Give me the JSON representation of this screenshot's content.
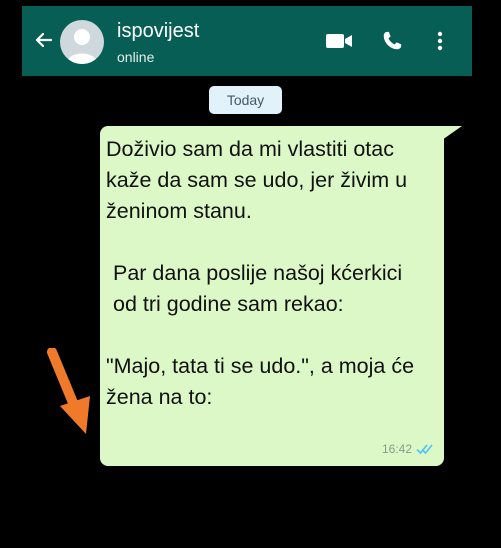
{
  "header": {
    "contact_name": "ispovijest",
    "status": "online"
  },
  "date_label": "Today",
  "message": {
    "paragraphs": [
      "Doživio sam da mi vlastiti otac kaže da sam se udo, jer živim u ženinom stanu.",
      "Par dana poslije našoj kćerkici od tri godine sam rekao:",
      "\"Majo, tata ti se udo.\", a moja će žena na to:"
    ],
    "time": "16:42",
    "receipt_icon": "double-check-icon"
  },
  "colors": {
    "header": "#075e54",
    "bubble": "#dcf8c6",
    "date_chip": "#e1f2fb",
    "annotation_arrow": "#f07a2a",
    "read_ticks": "#4fc3f7"
  }
}
